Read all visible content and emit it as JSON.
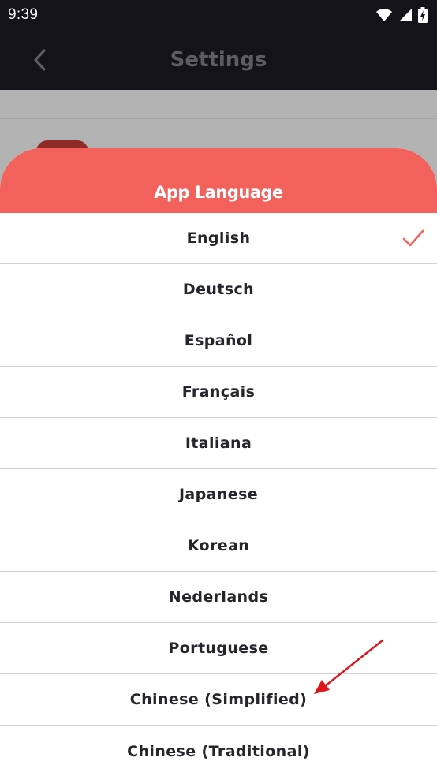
{
  "status_bar": {
    "time": "9:39",
    "icons": [
      "wifi-icon",
      "signal-icon",
      "battery-charging-icon"
    ]
  },
  "app_bar": {
    "title": "Settings",
    "back_icon": "chevron-left-icon"
  },
  "sheet": {
    "title": "App Language",
    "selected": "English",
    "languages": [
      "English",
      "Deutsch",
      "Español",
      "Français",
      "Italiana",
      "Japanese",
      "Korean",
      "Nederlands",
      "Portuguese",
      "Chinese (Simplified)",
      "Chinese (Traditional)"
    ]
  },
  "colors": {
    "accent": "#f2615c",
    "status_bar_bg": "#141319",
    "annotation_arrow": "#e0161b"
  }
}
